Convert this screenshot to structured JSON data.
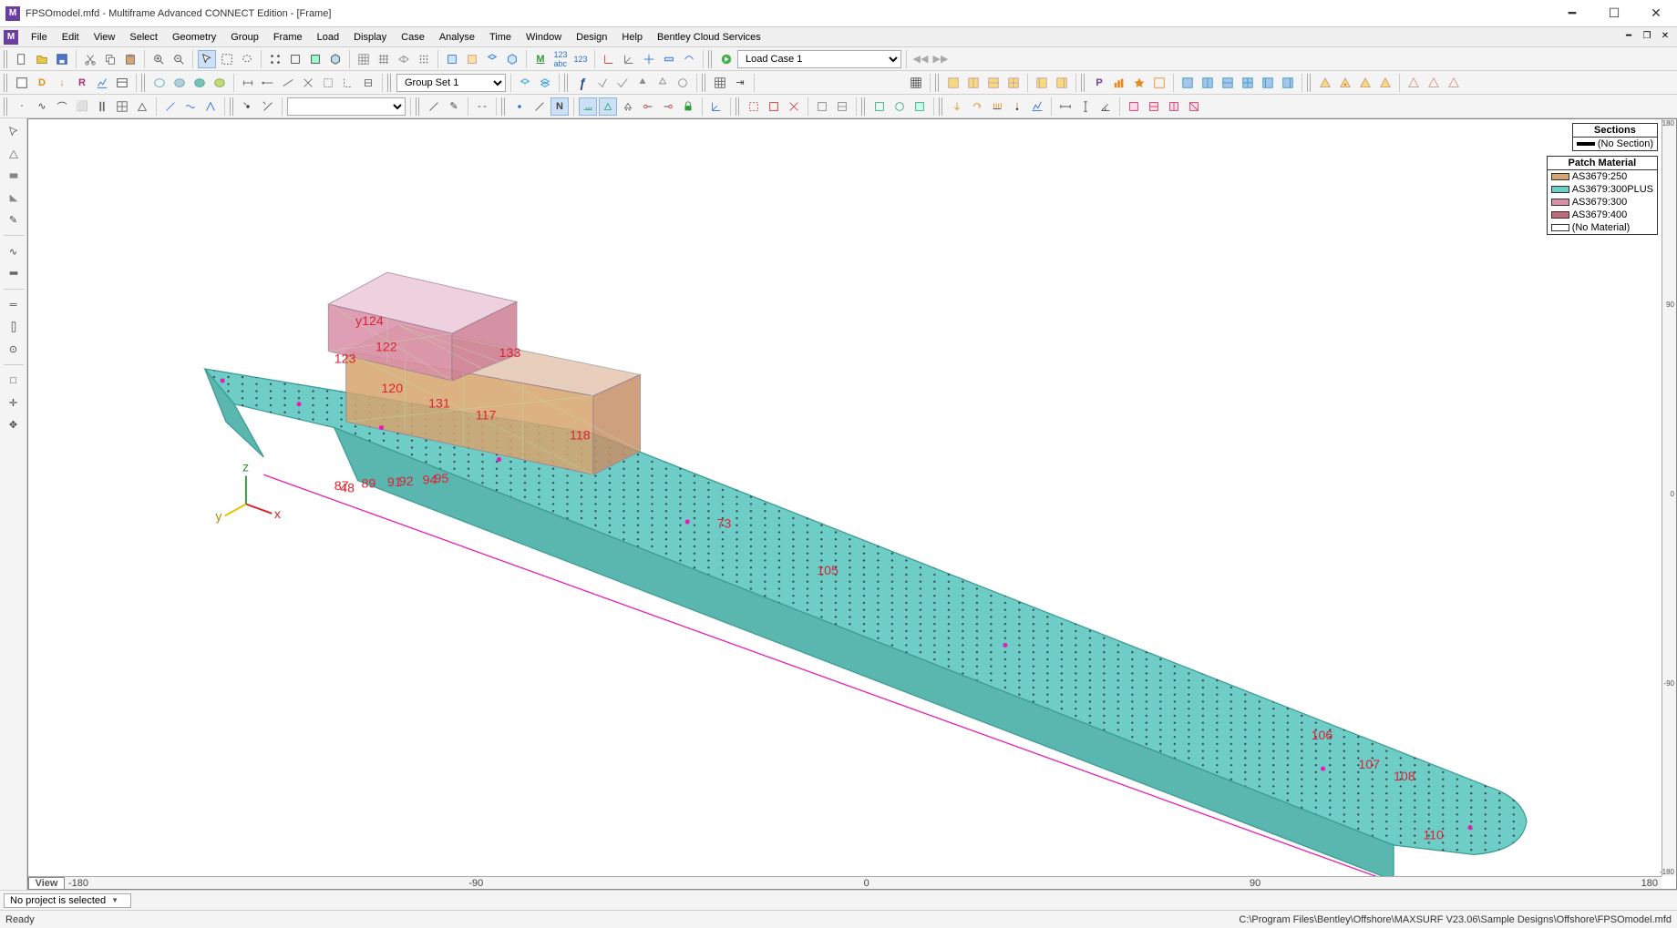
{
  "window": {
    "title": "FPSOmodel.mfd - Multiframe Advanced CONNECT Edition - [Frame]",
    "app_icon_char": "M"
  },
  "menubar": {
    "items": [
      "File",
      "Edit",
      "View",
      "Select",
      "Geometry",
      "Group",
      "Frame",
      "Load",
      "Display",
      "Case",
      "Analyse",
      "Time",
      "Window",
      "Design",
      "Help",
      "Bentley Cloud Services"
    ]
  },
  "load_case_combo": "Load Case 1",
  "group_set_combo": "Group Set 1",
  "view_tab": "View",
  "project_selector": "No project is selected",
  "status_left": "Ready",
  "status_right": "C:\\Program Files\\Bentley\\Offshore\\MAXSURF V23.06\\Sample Designs\\Offshore\\FPSOmodel.mfd",
  "rulers": {
    "x_ticks": [
      "-180",
      "-90",
      "0",
      "90",
      "180"
    ],
    "y_ticks": [
      "180",
      "90",
      "0",
      "-90",
      "-180"
    ]
  },
  "legend_sections": {
    "title": "Sections",
    "none": "(No Section)"
  },
  "legend_material": {
    "title": "Patch Material",
    "items": [
      {
        "label": "AS3679:250",
        "color": "#d7a56e"
      },
      {
        "label": "AS3679:300PLUS",
        "color": "#6fcdc7"
      },
      {
        "label": "AS3679:300",
        "color": "#d98fa8"
      },
      {
        "label": "AS3679:400",
        "color": "#c36a7a"
      },
      {
        "label": "(No Material)",
        "color": "#ffffff"
      }
    ]
  },
  "model_labels": {
    "hull": "105",
    "l73": "73",
    "l106": "106",
    "l107": "107",
    "l108": "108",
    "l117": "117",
    "l118": "118",
    "l120": "120",
    "l122": "122",
    "l123": "123",
    "l124": "y124",
    "l131": "131",
    "l133": "133",
    "l48": "48",
    "l87": "87",
    "l89": "89",
    "l91": "91",
    "l92": "92",
    "l94": "94",
    "l95": "95",
    "l110": "110"
  },
  "axis_labels": {
    "x": "x",
    "y": "y",
    "z": "z"
  }
}
